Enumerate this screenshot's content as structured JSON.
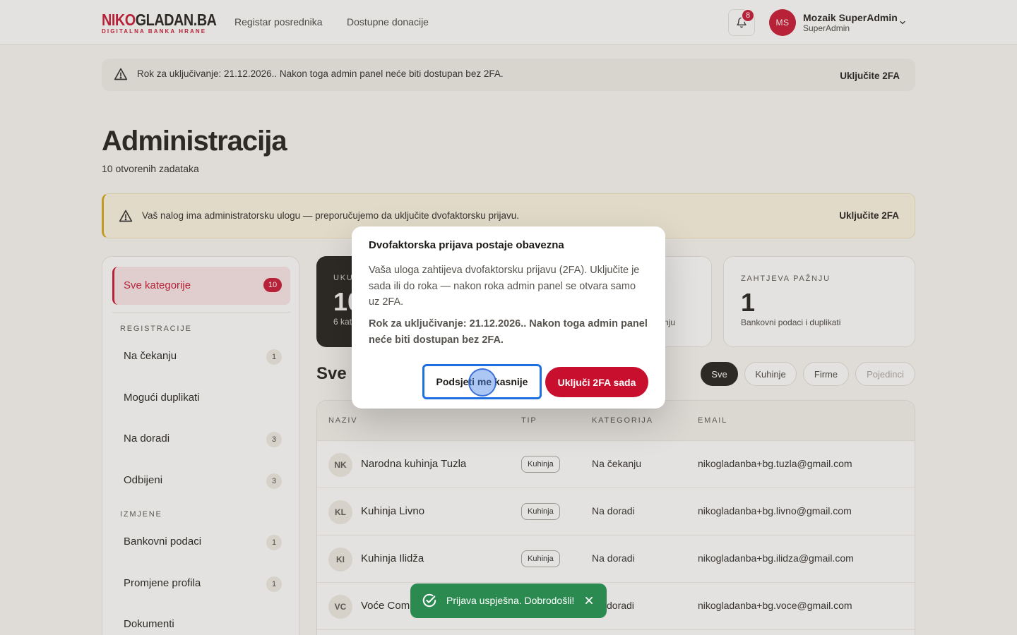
{
  "header": {
    "logo_primary": "NIKO",
    "logo_secondary": "GLADAN.BA",
    "logo_tagline": "DIGITALNA BANKA HRANE",
    "nav": [
      "Registar posrednika",
      "Dostupne donacije"
    ],
    "notification_count": "8",
    "user_initials": "MS",
    "user_name": "Mozaik SuperAdmin",
    "user_role": "SuperAdmin"
  },
  "top_banner": {
    "text": "Rok za uključivanje: 21.12.2026.. Nakon toga admin panel neće biti dostupan bez 2FA.",
    "action": "Uključite 2FA"
  },
  "page": {
    "title": "Administracija",
    "subtitle": "10 otvorenih zadataka"
  },
  "admin_banner": {
    "text": "Vaš nalog ima administratorsku ulogu — preporučujemo da uključite dvofaktorsku prijavu.",
    "action": "Uključite 2FA"
  },
  "sidebar": {
    "all": {
      "label": "Sve kategorije",
      "count": "10"
    },
    "sections": [
      {
        "heading": "REGISTRACIJE",
        "items": [
          {
            "label": "Na čekanju",
            "count": "1"
          },
          {
            "label": "Mogući duplikati",
            "count": ""
          },
          {
            "label": "Na doradi",
            "count": "3"
          },
          {
            "label": "Odbijeni",
            "count": "3"
          }
        ]
      },
      {
        "heading": "IZMJENE",
        "items": [
          {
            "label": "Bankovni podaci",
            "count": "1"
          },
          {
            "label": "Promjene profila",
            "count": "1"
          },
          {
            "label": "Dokumenti",
            "count": ""
          }
        ]
      }
    ]
  },
  "stats": [
    {
      "key": "UKU",
      "value": "10",
      "sub": "6 kat"
    },
    {
      "key": "",
      "value": "",
      "sub": "nju"
    },
    {
      "key": "ZAHTJEVA PAŽNJU",
      "value": "1",
      "sub": "Bankovni podaci i duplikati"
    }
  ],
  "section": {
    "title": "Sve k"
  },
  "filters": [
    {
      "label": "Sve",
      "active": true
    },
    {
      "label": "Kuhinje",
      "active": false
    },
    {
      "label": "Firme",
      "active": false
    },
    {
      "label": "Pojedinci",
      "active": false
    }
  ],
  "table": {
    "columns": [
      "NAZIV",
      "TIP",
      "KATEGORIJA",
      "EMAIL"
    ],
    "rows": [
      {
        "initials": "NK",
        "name": "Narodna kuhinja Tuzla",
        "type": "Kuhinja",
        "category": "Na čekanju",
        "email": "nikogladanba+bg.tuzla@gmail.com"
      },
      {
        "initials": "KL",
        "name": "Kuhinja Livno",
        "type": "Kuhinja",
        "category": "Na doradi",
        "email": "nikogladanba+bg.livno@gmail.com"
      },
      {
        "initials": "KI",
        "name": "Kuhinja Ilidža",
        "type": "Kuhinja",
        "category": "Na doradi",
        "email": "nikogladanba+bg.ilidza@gmail.com"
      },
      {
        "initials": "VC",
        "name": "Voće Comp",
        "type": "",
        "category": "doradi",
        "email": "nikogladanba+bg.voce@gmail.com"
      }
    ]
  },
  "modal": {
    "title": "Dvofaktorska prijava postaje obavezna",
    "body": "Vaša uloga zahtijeva dvofaktorsku prijavu (2FA). Uključite je sada ili do roka — nakon roka admin panel se otvara samo uz 2FA.",
    "deadline": "Rok za uključivanje: 21.12.2026.. Nakon toga admin panel neće biti dostupan bez 2FA.",
    "later_button": "Podsjeti me kasnije",
    "enable_button": "Uključi 2FA sada"
  },
  "toast": {
    "message": "Prijava uspješna. Dobrodošli!"
  },
  "colors": {
    "brand": "#c8102e",
    "warning": "#d9a40f",
    "success": "#2b8a50",
    "focus": "#1e6fe0"
  },
  "icons": [
    "warning-icon",
    "bell-icon",
    "chevron-down-icon",
    "check-circle-icon",
    "close-icon"
  ]
}
